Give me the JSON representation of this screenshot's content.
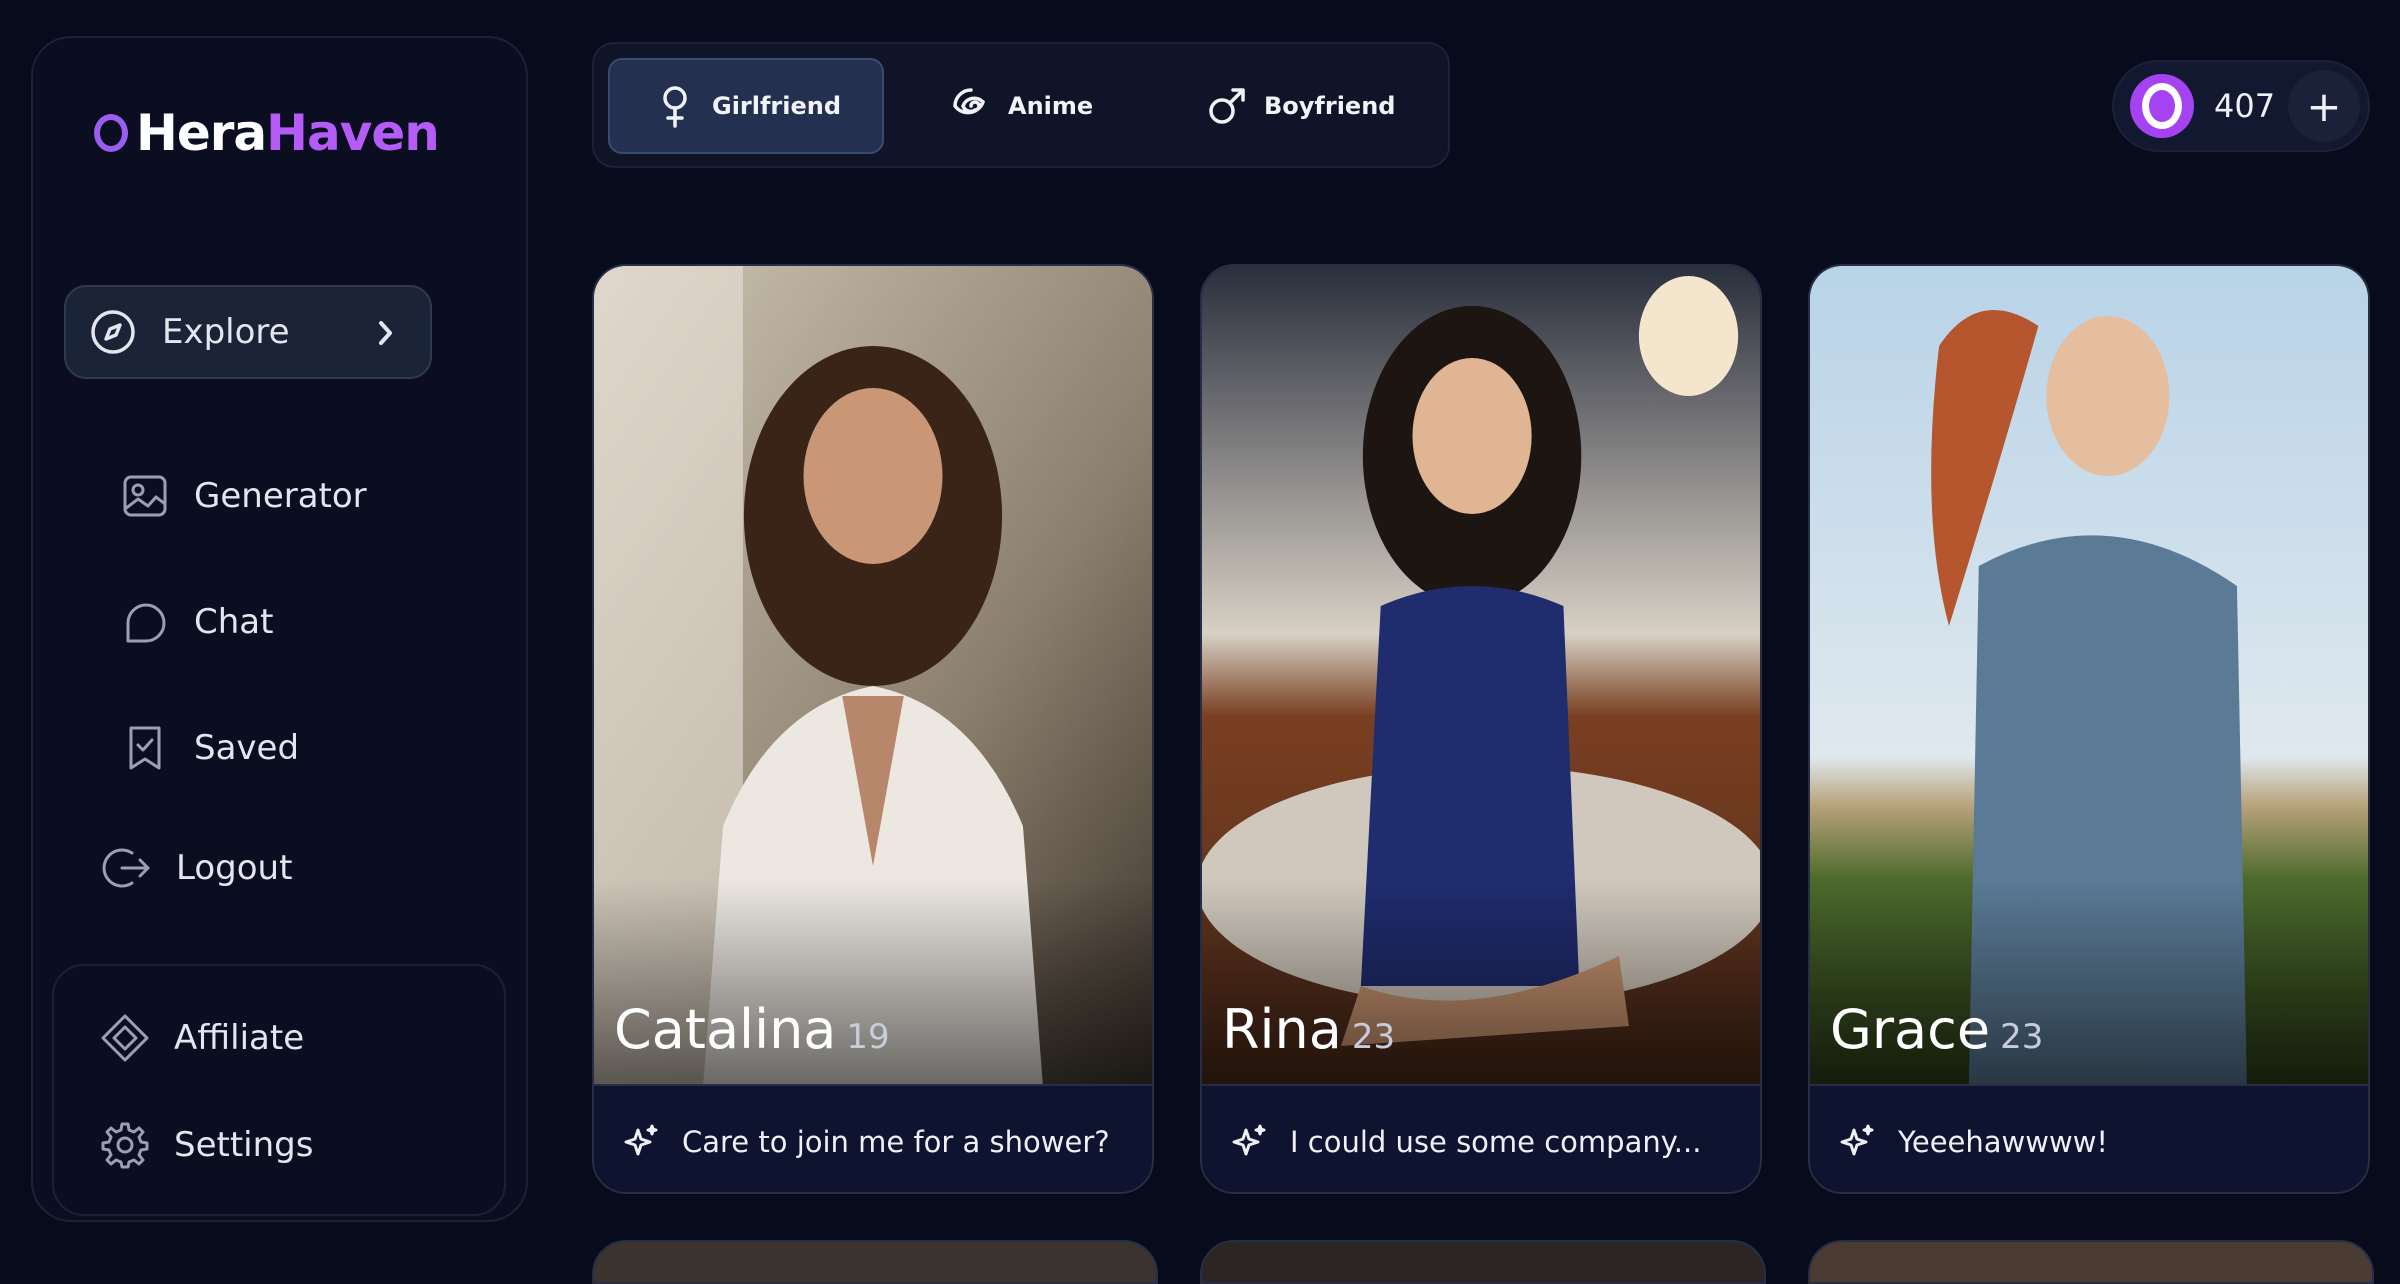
{
  "brand": {
    "part1": "Hera",
    "part2": "Haven"
  },
  "nav": {
    "items": [
      {
        "label": "Explore",
        "icon": "compass-icon"
      },
      {
        "label": "Generator",
        "icon": "image-gallery-icon"
      },
      {
        "label": "Chat",
        "icon": "chat-bubble-icon"
      },
      {
        "label": "Saved",
        "icon": "bookmark-check-icon"
      },
      {
        "label": "Logout",
        "icon": "logout-icon"
      }
    ],
    "secondary": [
      {
        "label": "Affiliate",
        "icon": "affiliate-icon"
      },
      {
        "label": "Settings",
        "icon": "gear-icon"
      }
    ]
  },
  "tabs": [
    {
      "label": "Girlfriend",
      "icon": "female-symbol-icon"
    },
    {
      "label": "Anime",
      "icon": "spiral-icon"
    },
    {
      "label": "Boyfriend",
      "icon": "male-symbol-icon"
    }
  ],
  "credits": {
    "count": "407",
    "add": "+"
  },
  "cards": [
    {
      "name": "Catalina",
      "age": "19",
      "message": "Care to join me for a shower?"
    },
    {
      "name": "Rina",
      "age": "23",
      "message": "I could use some company..."
    },
    {
      "name": "Grace",
      "age": "23",
      "message": "Yeeehawwww!"
    }
  ],
  "colors": {
    "accent": "#b45cf5",
    "background": "#080b1c",
    "active": "#233050"
  }
}
